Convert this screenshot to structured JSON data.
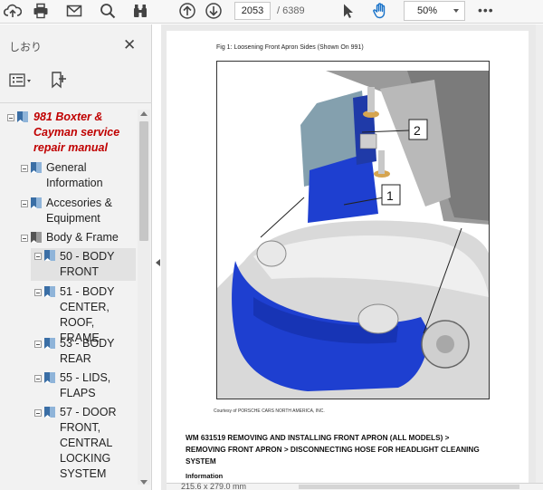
{
  "toolbar": {
    "page_current": "2053",
    "page_total": "/ 6389",
    "zoom": "50%",
    "more": "•••",
    "icons": [
      "cloud-upload-icon",
      "print-icon",
      "mail-icon",
      "search-icon",
      "binoculars-icon",
      "arrow-up-icon",
      "arrow-down-icon",
      "cursor-icon",
      "hand-icon"
    ]
  },
  "sidebar": {
    "title": "しおり",
    "close": "✕",
    "items": [
      {
        "label": "981 Boxter & Cayman service repair manual",
        "lines": [
          "981 Boxter &",
          "Cayman service",
          "repair manual"
        ]
      },
      {
        "label": "General Information",
        "lines": [
          "General",
          "Information"
        ]
      },
      {
        "label": "Accesories & Equipment",
        "lines": [
          "Accesories &",
          "Equipment"
        ]
      },
      {
        "label": "Body & Frame",
        "lines": [
          "Body & Frame"
        ]
      },
      {
        "label": "50 - BODY FRONT",
        "lines": [
          "50 - BODY",
          "FRONT"
        ]
      },
      {
        "label": "51 - BODY CENTER, ROOF, FRAME",
        "lines": [
          "51 - BODY",
          "CENTER,",
          "ROOF, FRAME"
        ]
      },
      {
        "label": "53 - BODY REAR",
        "lines": [
          "53 - BODY",
          "REAR"
        ]
      },
      {
        "label": "55 - LIDS, FLAPS",
        "lines": [
          "55 - LIDS,",
          "FLAPS"
        ]
      },
      {
        "label": "57 - DOOR FRONT, CENTRAL LOCKING SYSTEM",
        "lines": [
          "57 - DOOR",
          "FRONT,",
          "CENTRAL",
          "LOCKING",
          "SYSTEM"
        ]
      }
    ]
  },
  "document": {
    "fig_caption": "Fig 1: Loosening Front Apron Sides (Shown On 991)",
    "callouts": [
      "1",
      "2"
    ],
    "courtesy": "Courtesy of PORSCHE CARS NORTH AMERICA, INC.",
    "wm_lines": [
      "WM 631519 REMOVING AND INSTALLING FRONT APRON (ALL MODELS) >",
      "REMOVING FRONT APRON > DISCONNECTING HOSE FOR HEADLIGHT CLEANING",
      "SYSTEM"
    ],
    "info": "Information",
    "page_size": "215.6 x 279.0 mm"
  },
  "colors": {
    "root_bookmark": "#c00000",
    "apron_blue": "#1e3fd0",
    "toolbar_bg": "#f7f7f7"
  }
}
